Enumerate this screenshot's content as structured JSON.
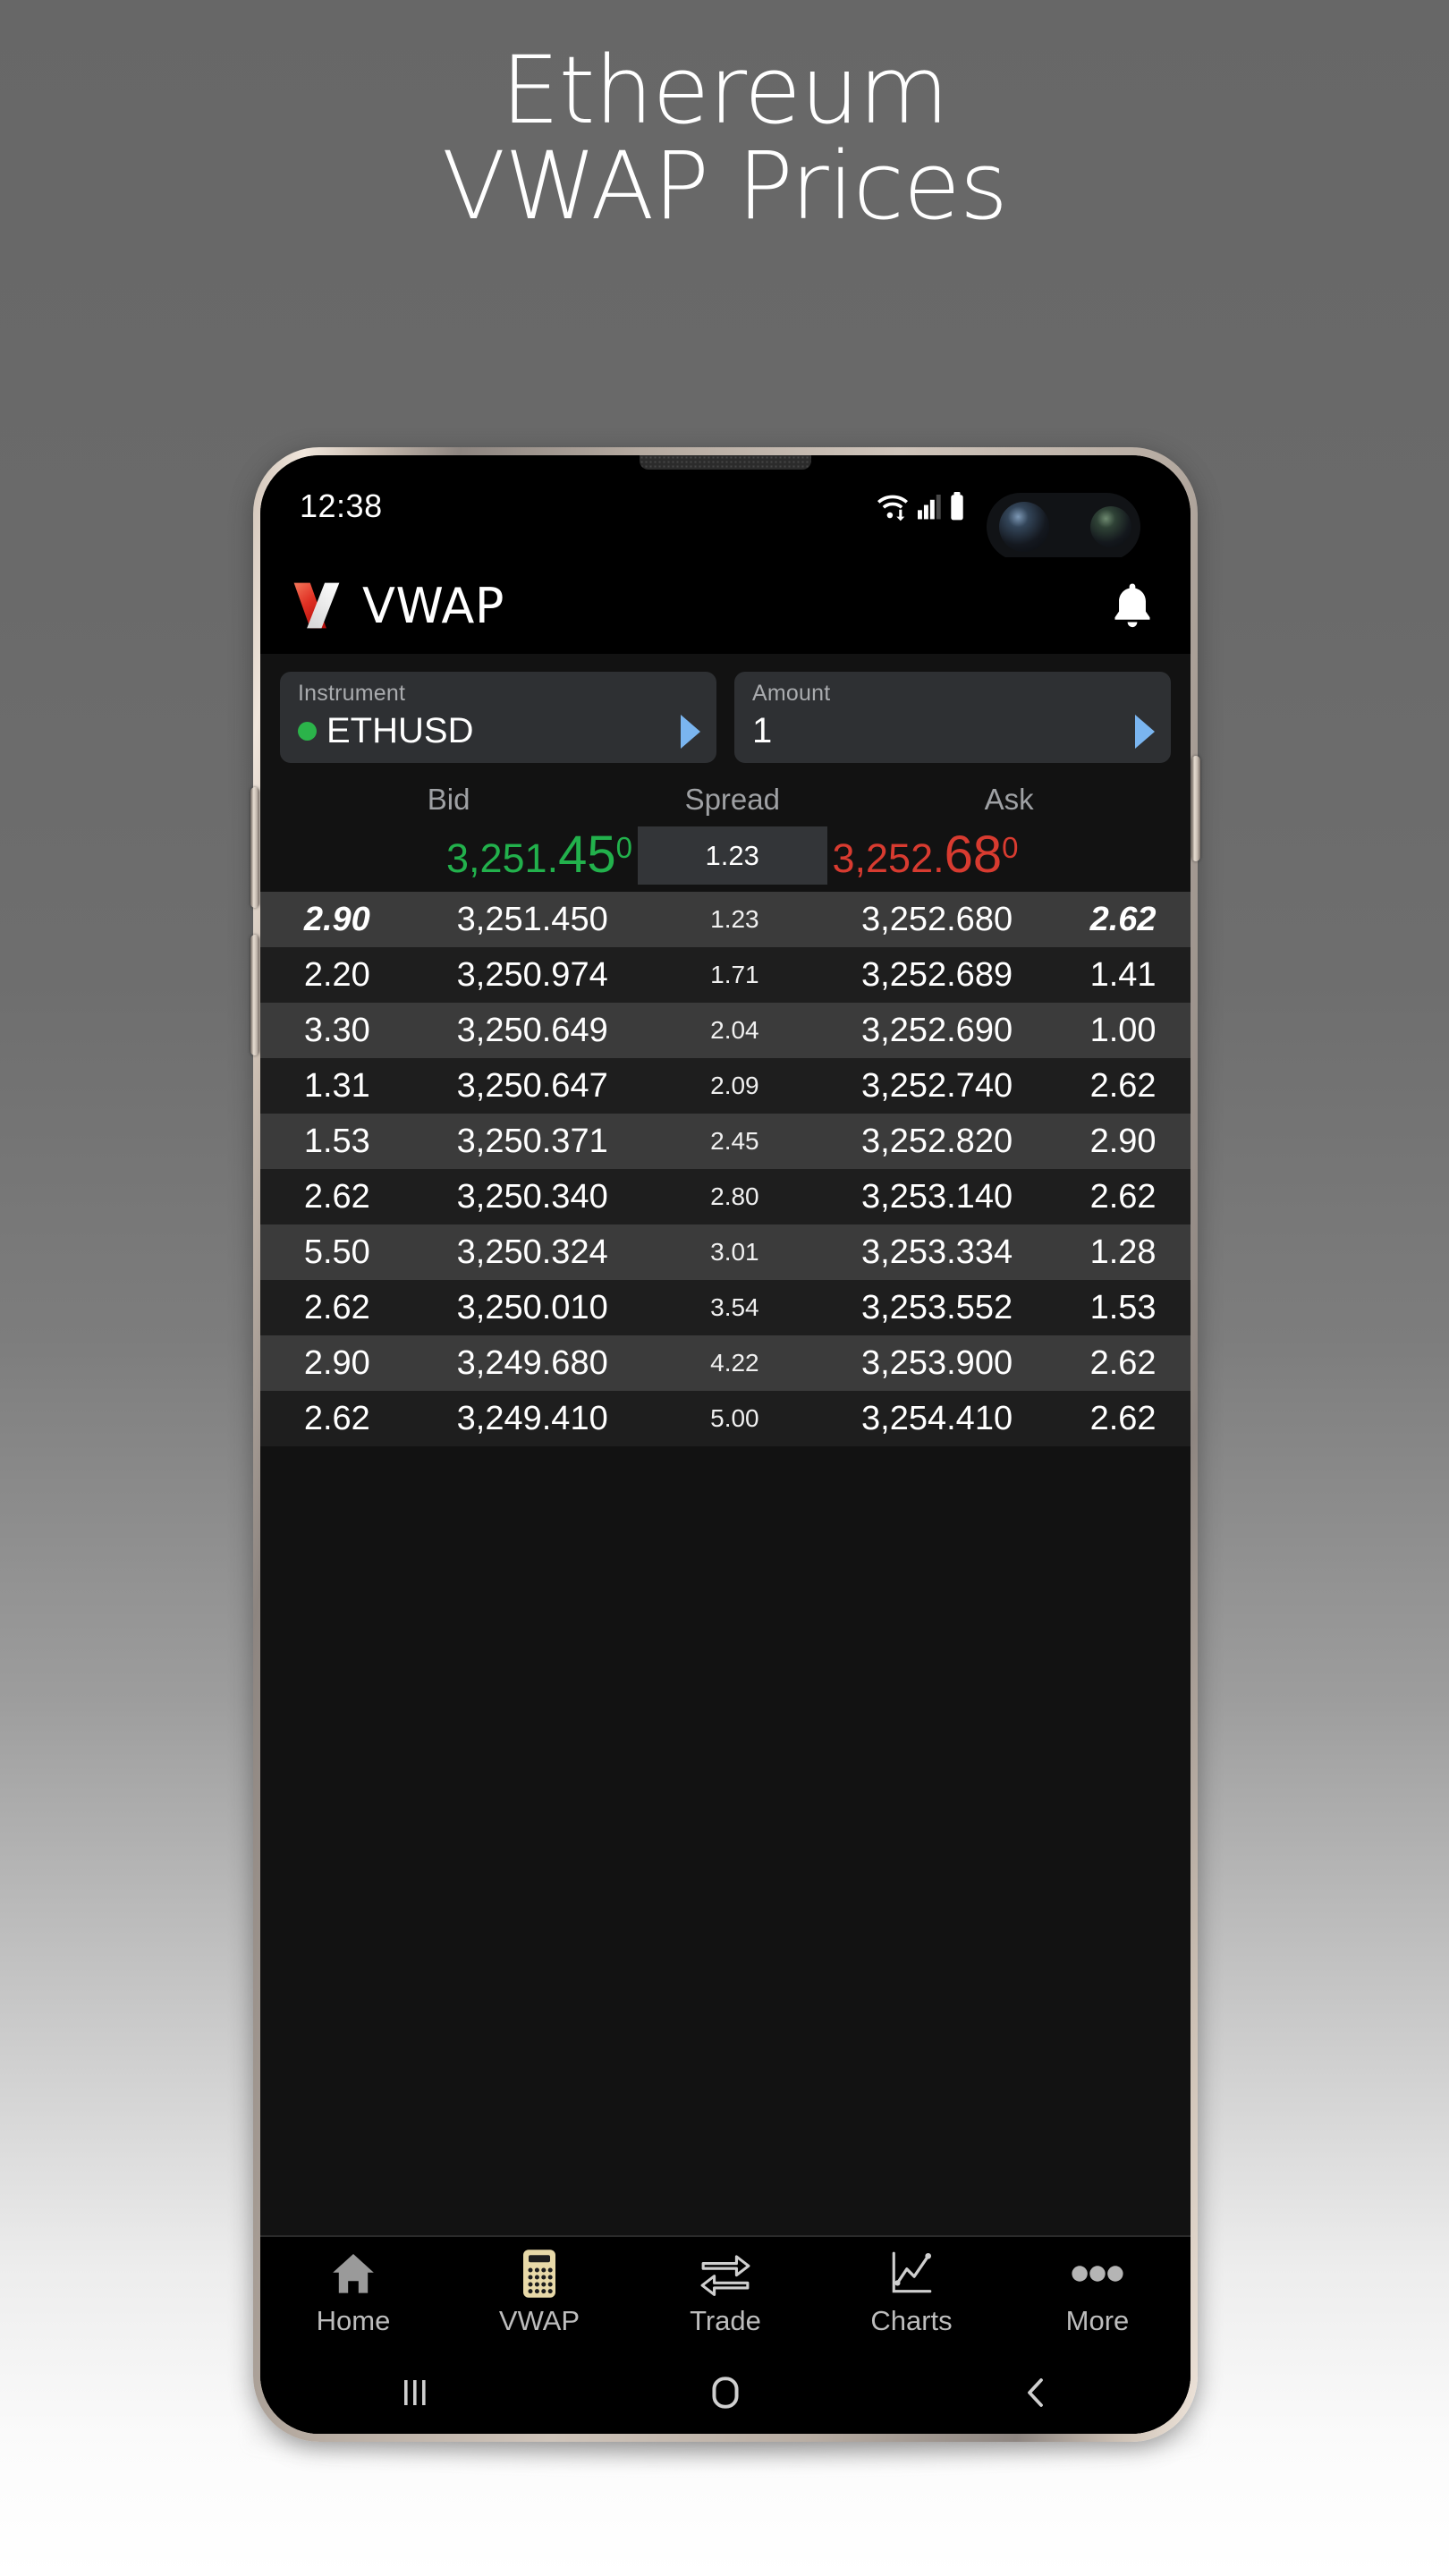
{
  "hero": {
    "line1": "Ethereum",
    "line2": "VWAP Prices"
  },
  "status_bar": {
    "time": "12:38",
    "wifi_icon": "wifi-icon",
    "signal_icon": "cellular-signal-icon",
    "battery_icon": "battery-icon"
  },
  "app_header": {
    "logo_icon": "x-logo-icon",
    "title": "VWAP",
    "bell_icon": "notification-bell-icon"
  },
  "selectors": {
    "instrument": {
      "label": "Instrument",
      "value": "ETHUSD",
      "status_dot_color": "#2bb34a",
      "arrow_icon": "chevron-right-icon"
    },
    "amount": {
      "label": "Amount",
      "value": "1",
      "arrow_icon": "chevron-right-icon"
    }
  },
  "quote_summary": {
    "headers": {
      "bid": "Bid",
      "spread": "Spread",
      "ask": "Ask"
    },
    "bid": {
      "lead": "3,251.",
      "big": "45",
      "sup": "0",
      "color": "#22b14c"
    },
    "spread": "1.23",
    "ask": {
      "lead": "3,252.",
      "big": "68",
      "sup": "0",
      "color": "#d83b30"
    }
  },
  "quote_table": {
    "columns": [
      "bid_size",
      "bid_price",
      "spread",
      "ask_price",
      "ask_size"
    ],
    "rows": [
      {
        "bid_size": "2.90",
        "bid_price": "3,251.450",
        "spread": "1.23",
        "ask_price": "3,252.680",
        "ask_size": "2.62",
        "highlight": true
      },
      {
        "bid_size": "2.20",
        "bid_price": "3,250.974",
        "spread": "1.71",
        "ask_price": "3,252.689",
        "ask_size": "1.41",
        "highlight": false
      },
      {
        "bid_size": "3.30",
        "bid_price": "3,250.649",
        "spread": "2.04",
        "ask_price": "3,252.690",
        "ask_size": "1.00",
        "highlight": false
      },
      {
        "bid_size": "1.31",
        "bid_price": "3,250.647",
        "spread": "2.09",
        "ask_price": "3,252.740",
        "ask_size": "2.62",
        "highlight": false
      },
      {
        "bid_size": "1.53",
        "bid_price": "3,250.371",
        "spread": "2.45",
        "ask_price": "3,252.820",
        "ask_size": "2.90",
        "highlight": false
      },
      {
        "bid_size": "2.62",
        "bid_price": "3,250.340",
        "spread": "2.80",
        "ask_price": "3,253.140",
        "ask_size": "2.62",
        "highlight": false
      },
      {
        "bid_size": "5.50",
        "bid_price": "3,250.324",
        "spread": "3.01",
        "ask_price": "3,253.334",
        "ask_size": "1.28",
        "highlight": false
      },
      {
        "bid_size": "2.62",
        "bid_price": "3,250.010",
        "spread": "3.54",
        "ask_price": "3,253.552",
        "ask_size": "1.53",
        "highlight": false
      },
      {
        "bid_size": "2.90",
        "bid_price": "3,249.680",
        "spread": "4.22",
        "ask_price": "3,253.900",
        "ask_size": "2.62",
        "highlight": false
      },
      {
        "bid_size": "2.62",
        "bid_price": "3,249.410",
        "spread": "5.00",
        "ask_price": "3,254.410",
        "ask_size": "2.62",
        "highlight": false
      }
    ]
  },
  "bottom_nav": {
    "items": [
      {
        "label": "Home",
        "icon": "home-icon",
        "active": false
      },
      {
        "label": "VWAP",
        "icon": "calculator-icon",
        "active": true
      },
      {
        "label": "Trade",
        "icon": "exchange-arrows-icon",
        "active": false
      },
      {
        "label": "Charts",
        "icon": "line-chart-icon",
        "active": false
      },
      {
        "label": "More",
        "icon": "ellipsis-icon",
        "active": false
      }
    ]
  },
  "android_nav": {
    "recents_icon": "recent-apps-icon",
    "home_icon": "home-square-icon",
    "back_icon": "back-chevron-icon"
  }
}
